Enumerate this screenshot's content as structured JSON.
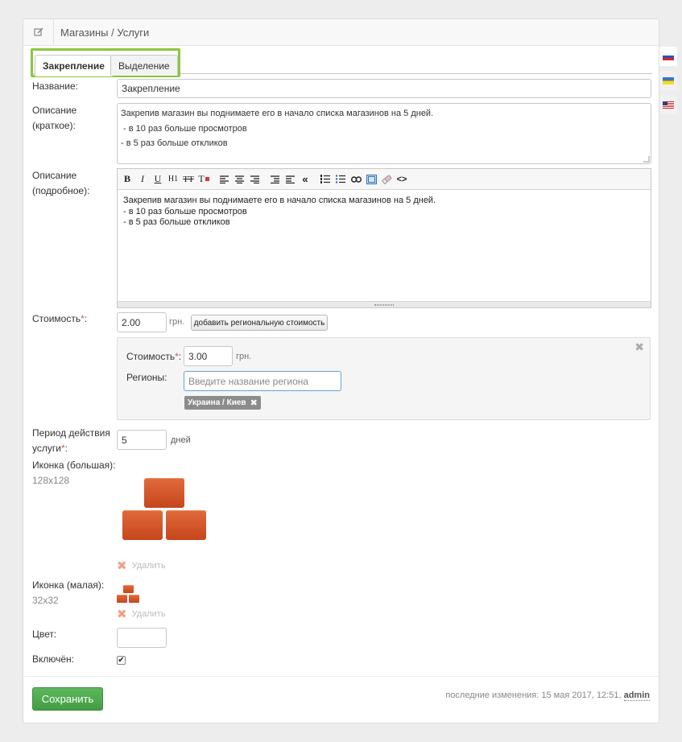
{
  "header": {
    "title": "Магазины / Услуги",
    "icon": "edit-icon"
  },
  "tabs": [
    {
      "label": "Закрепление",
      "active": true
    },
    {
      "label": "Выделение",
      "active": false
    }
  ],
  "form": {
    "name_label": "Название:",
    "name_value": "Закрепление",
    "short_desc_label_1": "Описание",
    "short_desc_label_2": "(краткое):",
    "short_desc_lines": [
      "Закрепив магазин вы поднимаете его в начало списка магазинов на 5 дней.",
      " - в 10 раз больше просмотров",
      "- в 5 раз больше откликов"
    ],
    "full_desc_label_1": "Описание",
    "full_desc_label_2": "(подробное):",
    "full_desc_lines": [
      "Закрепив магазин вы поднимаете его в начало списка магазинов на 5 дней.",
      "- в 10 раз больше просмотров",
      "- в 5 раз больше откликов"
    ],
    "price_label": "Стоимость",
    "required_mark": "*",
    "colon": ":",
    "price_value": "2.00",
    "currency": "грн.",
    "add_regional_button": "добавить региональную стоимость",
    "regional": {
      "price_label": "Стоимость",
      "price_value": "3.00",
      "currency": "грн.",
      "regions_label": "Регионы:",
      "regions_placeholder": "Введите название региона",
      "region_tag": "Украина / Киев"
    },
    "period_label_1": "Период действия",
    "period_label_2": "услуги",
    "period_value": "5",
    "period_unit": "дней",
    "icon_big_label": "Иконка (большая):",
    "icon_big_size": "128x128",
    "icon_small_label": "Иконка (малая):",
    "icon_small_size": "32x32",
    "delete_label": "Удалить",
    "color_label": "Цвет:",
    "enabled_label": "Включён:",
    "enabled_checked": true
  },
  "footer": {
    "save_button": "Сохранить",
    "last_changes": "последние изменения: 15 мая 2017, 12:51,",
    "author": "admin"
  },
  "languages": [
    "ru-flag",
    "ua-flag",
    "us-flag"
  ],
  "colors": {
    "accent_green": "#8cc63f",
    "save_green": "#5cb85c",
    "brick": "#d55a2b"
  }
}
